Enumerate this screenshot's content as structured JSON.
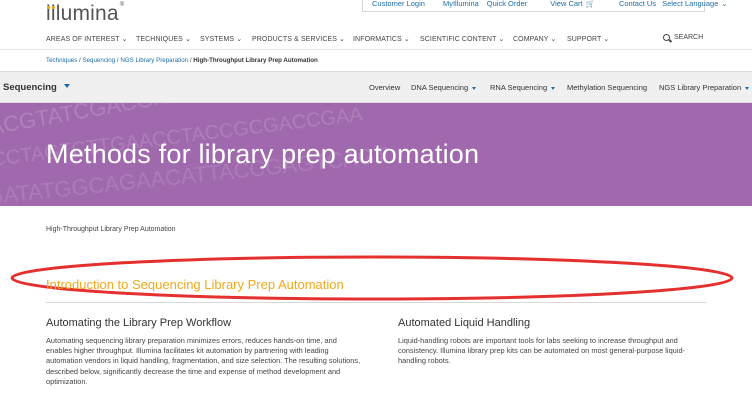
{
  "brand": {
    "logo_text": "illumina",
    "logo_mark": "®"
  },
  "util_links": [
    "Customer Login",
    "MyIllumina",
    "Quick Order",
    "View Cart",
    "Contact Us",
    "Select Language"
  ],
  "main_nav": [
    "AREAS OF INTEREST",
    "TECHNIQUES",
    "SYSTEMS",
    "PRODUCTS & SERVICES",
    "INFORMATICS",
    "SCIENTIFIC CONTENT",
    "COMPANY",
    "SUPPORT"
  ],
  "search_label": "SEARCH",
  "breadcrumb": {
    "items": [
      "Techniques",
      "Sequencing",
      "NGS Library Preparation"
    ],
    "separator": " / ",
    "current": "High-Throughput Library Prep Automation"
  },
  "sub_nav": {
    "title": "Sequencing",
    "items": [
      "Overview",
      "DNA Sequencing",
      "RNA Sequencing",
      "Methylation Sequencing",
      "NGS Library Preparation"
    ]
  },
  "hero": {
    "title": "Methods for library prep automation",
    "sequence_lines": [
      "ACGTATCGACGACATTACGG",
      "TCCTAGTCTTGAACCTACCGCGACCGAA",
      "GGATATGGCAGAACATTACCGAGTCAGT"
    ]
  },
  "page_subtitle": "High-Throughput Library Prep Automation",
  "section_title": "Introduction to Sequencing Library Prep Automation",
  "columns": [
    {
      "title": "Automating the Library Prep Workflow",
      "text": "Automating sequencing library preparation minimizes errors, reduces hands-on time, and enables higher throughput. Illumina facilitates kit automation by partnering with leading automation vendors in liquid handling, fragmentation, and size selection. The resulting solutions, described below, significantly decrease the time and expense of method development and optimization."
    },
    {
      "title": "Automated Liquid Handling",
      "text": "Liquid-handling robots are important tools for labs seeking to increase throughput and consistency. Illumina library prep kits can be automated on most general-purpose liquid-handling robots."
    }
  ],
  "colors": {
    "hero": "#a069ad",
    "accent": "#f0a91b",
    "link": "#1e6ca8",
    "annotation": "#e53030"
  }
}
